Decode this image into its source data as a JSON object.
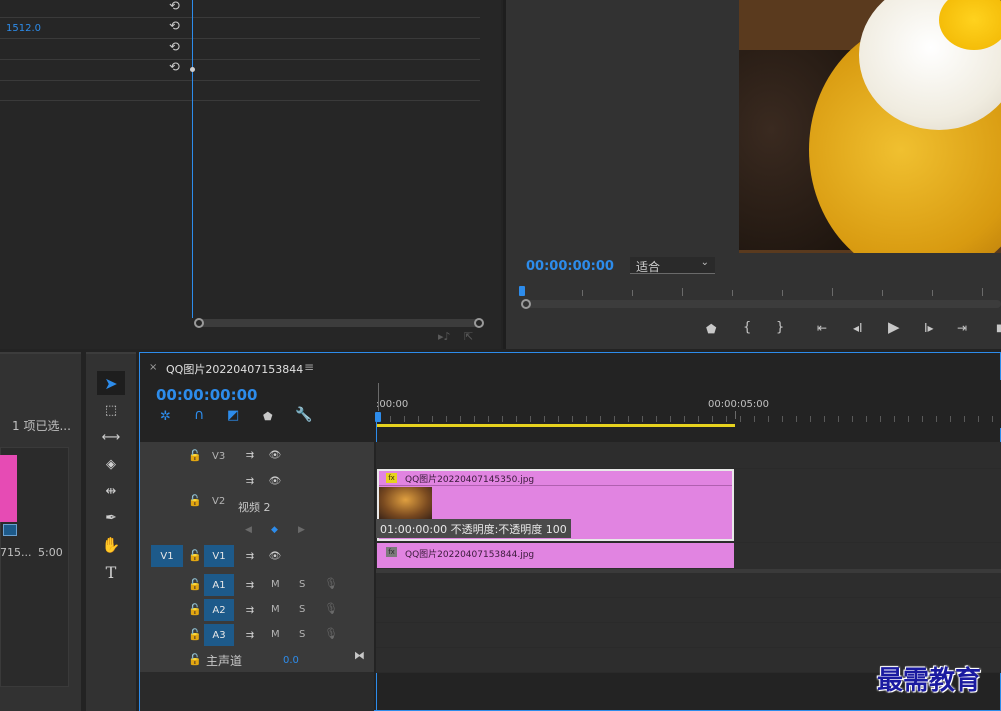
{
  "effect_controls": {
    "value_1": "1512.0",
    "reset_icons": [
      "reset-icon",
      "reset-icon",
      "reset-icon",
      "reset-icon"
    ]
  },
  "program_monitor": {
    "timecode": "00:00:00:00",
    "fit_label": "适合",
    "fit_arrow": "⌄"
  },
  "project": {
    "selected_label": "1 项已选...",
    "clip_name": "715...",
    "clip_duration": "5:00"
  },
  "timeline": {
    "tab_title": "QQ图片20220407153844",
    "close": "×",
    "menu": "≡",
    "timecode": "00:00:00:00",
    "ruler_start": ":00:00",
    "ruler_mid": "00:00:05:00",
    "tracks": {
      "v3": "V3",
      "v2": "V2",
      "v2_name": "视频 2",
      "v1_source": "V1",
      "v1": "V1",
      "a1": "A1",
      "a2": "A2",
      "a3": "A3",
      "m": "M",
      "s": "S",
      "master": "主声道",
      "master_value": "0.0"
    },
    "clips": {
      "v2_name": "QQ图片20220407145350.jpg",
      "v2_tooltip": "01:00:00:00  不透明度:不透明度  100",
      "v1_name": "QQ图片20220407153844.jpg"
    },
    "fx": "fx"
  },
  "watermark": "最需教育",
  "colors": {
    "accent": "#2d8ceb",
    "clip": "#e184e1",
    "track_active": "#1d5a8a",
    "work_area": "#e6d21e",
    "project_thumb": "#e64bb4"
  }
}
